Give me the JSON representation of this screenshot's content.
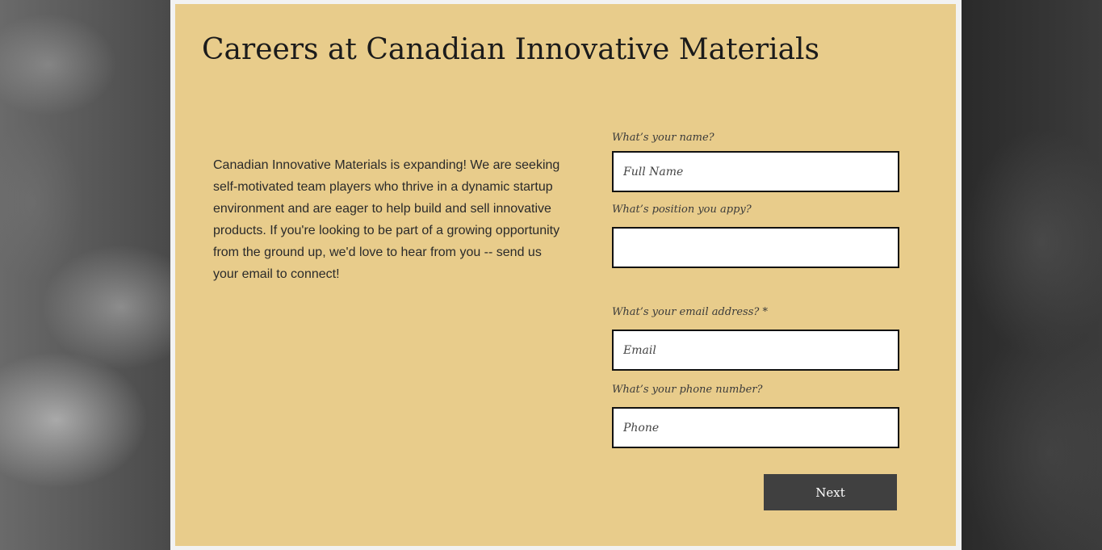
{
  "page": {
    "title": "Careers at Canadian Innovative Materials",
    "intro": "Canadian Innovative Materials is expanding! We are seeking self-motivated team players who thrive in a dynamic startup environment and are eager to help build and sell innovative products. If you're looking to be part of a growing opportunity from the ground up, we'd love to hear from you -- send us your email to connect!"
  },
  "form": {
    "name": {
      "label": "What’s your name?",
      "placeholder": "Full Name",
      "value": ""
    },
    "position": {
      "label": "What’s position you appy?",
      "placeholder": "",
      "value": ""
    },
    "email": {
      "label": "What’s your email address? *",
      "placeholder": "Email",
      "value": ""
    },
    "phone": {
      "label": "What’s your phone number?",
      "placeholder": "Phone",
      "value": ""
    },
    "next_label": "Next"
  },
  "colors": {
    "panel_background": "#e8cc8b",
    "panel_border": "#f2f2f2",
    "button_background": "#404040",
    "button_text": "#ffffff"
  }
}
